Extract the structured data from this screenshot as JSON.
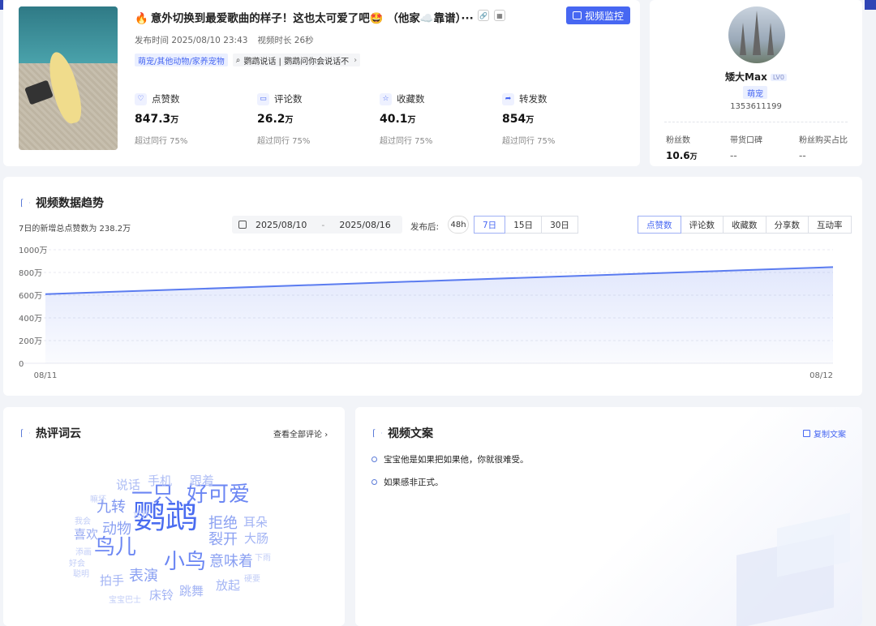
{
  "video": {
    "fire_icon": "fire-icon",
    "title": "意外切换到最爱歌曲的样子！这也太可爱了吧🤩 （他家☁️靠谱）···",
    "link_icon": "🔗",
    "qr_icon": "▦",
    "monitor_label": "视频监控",
    "publish_time": "发布时间  2025/08/10 23:43",
    "duration": "视频时长  26秒",
    "category_tag": "萌宠/其他动物/家养宠物",
    "topic_tag": "鹦鹉说话 | 鹦鹉问你会说话不",
    "topic_arrow": "›"
  },
  "stats": [
    {
      "icon": "♡",
      "label": "点赞数",
      "value": "847.3",
      "unit": "万",
      "sub": "超过同行 75%"
    },
    {
      "icon": "▭",
      "label": "评论数",
      "value": "26.2",
      "unit": "万",
      "sub": "超过同行 75%"
    },
    {
      "icon": "☆",
      "label": "收藏数",
      "value": "40.1",
      "unit": "万",
      "sub": "超过同行 75%"
    },
    {
      "icon": "➦",
      "label": "转发数",
      "value": "854",
      "unit": "万",
      "sub": "超过同行 75%"
    }
  ],
  "author": {
    "name": "矮大Max",
    "level": "LV0",
    "category": "萌宠",
    "id": "1353611199",
    "metrics": [
      {
        "label": "粉丝数",
        "value": "10.6",
        "unit": "万"
      },
      {
        "label": "带货口碑",
        "value": "--",
        "unit": ""
      },
      {
        "label": "粉丝购买占比",
        "value": "--",
        "unit": ""
      }
    ]
  },
  "trend": {
    "title": "视频数据趋势",
    "subtitle": "7日的新增总点赞数为 238.2万",
    "date_start": "2025/08/10",
    "date_sep": "-",
    "date_end": "2025/08/16",
    "publish_label": "发布后:",
    "range_48h": "48h",
    "ranges": [
      "7日",
      "15日",
      "30日"
    ],
    "active_range": 0,
    "metrics": [
      "点赞数",
      "评论数",
      "收藏数",
      "分享数",
      "互动率"
    ],
    "active_metric": 0
  },
  "chart_data": {
    "type": "area",
    "x": [
      "08/11",
      "08/12"
    ],
    "series": [
      {
        "values": [
          609,
          847.3
        ]
      }
    ],
    "y_ticks": [
      "0",
      "200万",
      "400万",
      "600万",
      "800万",
      "1000万"
    ],
    "ylim": [
      0,
      1000
    ],
    "x_tick_labels": [
      "08/11",
      "08/12"
    ],
    "color": "#5b7cf0",
    "grid": true
  },
  "cloud": {
    "title": "热评词云",
    "view_all": "查看全部评论",
    "view_all_arrow": "›",
    "words": [
      {
        "text": "鹦鹉",
        "size": 40,
        "color": "#4a6cf0"
      },
      {
        "text": "好可爱",
        "size": 26,
        "color": "#6b86f3"
      },
      {
        "text": "一只",
        "size": 26,
        "color": "#6b86f3"
      },
      {
        "text": "小鸟",
        "size": 26,
        "color": "#6b86f3"
      },
      {
        "text": "鸟儿",
        "size": 26,
        "color": "#6b86f3"
      },
      {
        "text": "九转",
        "size": 18,
        "color": "#7f96f0"
      },
      {
        "text": "拒绝",
        "size": 18,
        "color": "#8aa0f2"
      },
      {
        "text": "裂开",
        "size": 18,
        "color": "#8aa0f2"
      },
      {
        "text": "意味着",
        "size": 18,
        "color": "#8aa0f2"
      },
      {
        "text": "表演",
        "size": 18,
        "color": "#8aa0f2"
      },
      {
        "text": "动物",
        "size": 18,
        "color": "#8aa0f2"
      },
      {
        "text": "喜欢",
        "size": 15,
        "color": "#9aacf2"
      },
      {
        "text": "大肠",
        "size": 15,
        "color": "#a3b4f4"
      },
      {
        "text": "耳朵",
        "size": 15,
        "color": "#a3b4f4"
      },
      {
        "text": "放起",
        "size": 15,
        "color": "#a3b4f4"
      },
      {
        "text": "跳舞",
        "size": 15,
        "color": "#a3b4f4"
      },
      {
        "text": "拍手",
        "size": 15,
        "color": "#a3b4f4"
      },
      {
        "text": "床铃",
        "size": 15,
        "color": "#a3b4f4"
      },
      {
        "text": "说话",
        "size": 15,
        "color": "#aebdf5"
      },
      {
        "text": "手机",
        "size": 15,
        "color": "#aebdf5"
      },
      {
        "text": "跟着",
        "size": 15,
        "color": "#aebdf5"
      },
      {
        "text": "世界",
        "size": 10,
        "color": "#c3cef7"
      },
      {
        "text": "嘛坏",
        "size": 10,
        "color": "#c3cef7"
      },
      {
        "text": "我会",
        "size": 10,
        "color": "#c3cef7"
      },
      {
        "text": "添画",
        "size": 10,
        "color": "#c3cef7"
      },
      {
        "text": "好会",
        "size": 10,
        "color": "#c3cef7"
      },
      {
        "text": "聪明",
        "size": 10,
        "color": "#c3cef7"
      },
      {
        "text": "下雨",
        "size": 10,
        "color": "#c3cef7"
      },
      {
        "text": "硬要",
        "size": 10,
        "color": "#c3cef7"
      },
      {
        "text": "宝宝巴士",
        "size": 10,
        "color": "#c3cef7"
      }
    ]
  },
  "copywriting": {
    "title": "视频文案",
    "copy_label": "复制文案",
    "lines": [
      "宝宝他是如果把如果他，你就很难受。",
      "如果感非正式。"
    ]
  }
}
